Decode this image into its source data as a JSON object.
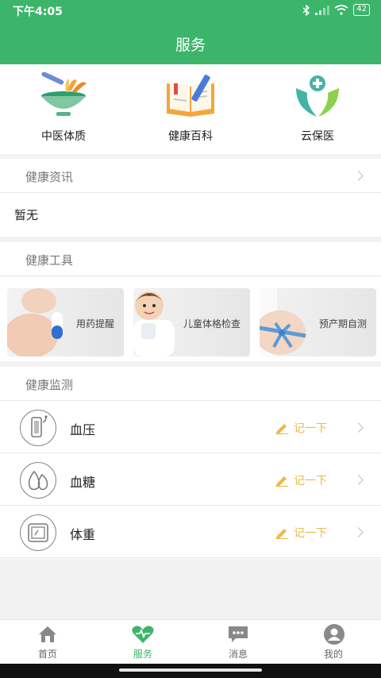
{
  "status_bar": {
    "time": "下午4:05",
    "battery": "42"
  },
  "header": {
    "title": "服务"
  },
  "quick_entries": [
    {
      "label": "中医体质",
      "icon": "herbal-bowl-icon"
    },
    {
      "label": "健康百科",
      "icon": "book-pen-icon"
    },
    {
      "label": "云保医",
      "icon": "care-hands-icon"
    }
  ],
  "news": {
    "title": "健康资讯",
    "empty_text": "暂无"
  },
  "tools": {
    "title": "健康工具",
    "cards": [
      {
        "label": "用药提醒",
        "icon": "pill-icon"
      },
      {
        "label": "儿童体格检查",
        "icon": "child-icon"
      },
      {
        "label": "预产期自测",
        "icon": "pregnancy-icon"
      }
    ]
  },
  "monitor": {
    "title": "健康监测",
    "record_label": "记一下",
    "items": [
      {
        "name": "血压",
        "icon": "blood-pressure-icon"
      },
      {
        "name": "血糖",
        "icon": "blood-sugar-icon"
      },
      {
        "name": "体重",
        "icon": "weight-scale-icon"
      }
    ]
  },
  "tabbar": {
    "active": "服务",
    "accent": "#3cb56a",
    "items": [
      {
        "label": "首页",
        "icon": "home-icon"
      },
      {
        "label": "服务",
        "icon": "heart-icon"
      },
      {
        "label": "消息",
        "icon": "message-icon"
      },
      {
        "label": "我的",
        "icon": "profile-icon"
      }
    ]
  }
}
